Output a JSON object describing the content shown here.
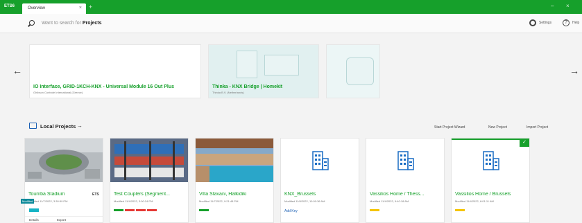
{
  "titlebar": {
    "app": "ETS6",
    "tab_label": "Overview",
    "tab_close": "×",
    "tab_add": "+",
    "minimize": "–",
    "close": "×",
    "color": "#16a02b"
  },
  "search": {
    "placeholder": "Want to search for",
    "scope": "Projects",
    "settings_label": "Settings",
    "help_label": "Help"
  },
  "carousel": {
    "prev": "←",
    "next": "→",
    "banners": [
      {
        "title": "IO Interface, GRID-1KCH-KNX - Universal Module 16 Out Plus",
        "subtitle": "Ghibson Controle International (Greece)"
      },
      {
        "title": "Thinka - KNX Bridge | Homekit",
        "subtitle": "Thinka B.V. (Netherlands)"
      }
    ]
  },
  "local_projects": {
    "title": "Local Projects",
    "arrow": "→",
    "actions": [
      "Start Project Wizard",
      "New Project",
      "Import Project"
    ]
  },
  "projects": [
    {
      "title": "Toumba Stadium",
      "meta": "Modified 11/7/2022, 3:30:59 PM",
      "badge": "ETS",
      "tags": [],
      "footer": [
        "Details",
        "Export"
      ]
    },
    {
      "title": "Test Couplers (Segment...",
      "meta": "Modified 11/4/2022, 3:00:24 PM",
      "tags": [
        "#16a02b",
        "#e53935",
        "#e53935",
        "#e53935"
      ]
    },
    {
      "title": "Villa Stavani, Halkidiki",
      "meta": "Modified 11/7/2022, 9:21:48 PM",
      "tags": [
        "#16a02b"
      ]
    },
    {
      "title": "KNX_Brussels",
      "meta": "Modified 11/8/2022, 10:00:36 AM",
      "add_key": "Add Key",
      "tags": []
    },
    {
      "title": "Vassilios Home / Thess...",
      "meta": "Modified 11/4/2022, 9:40:18 AM",
      "tags": [
        "#f5c400"
      ]
    },
    {
      "title": "Vassilios Home / Brussels",
      "meta": "Modified 11/4/2022, 8:01:11 AM",
      "tags": [
        "#f5c400"
      ],
      "check": "✓"
    }
  ],
  "tooltip": "Modified"
}
